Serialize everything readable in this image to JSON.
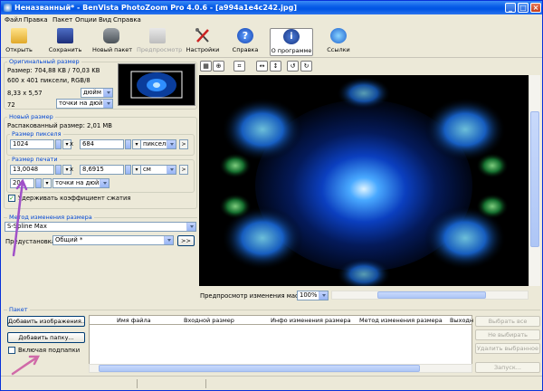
{
  "window": {
    "title": "Неназванный* - BenVista PhotoZoom Pro 4.0.6 - [a994a1e4c242.jpg]"
  },
  "menu": [
    "Файл",
    "Правка",
    "Пакет",
    "Опции",
    "Вид",
    "Справка"
  ],
  "toolbar": {
    "open": "Открыть",
    "save": "Сохранить",
    "new_batch": "Новый пакет",
    "preview": "Предпросмотр",
    "settings": "Настройки",
    "help": "Справка",
    "about": "О программе",
    "links": "Ссылки"
  },
  "original": {
    "group_label": "Оригинальный размер",
    "size_line": "Размер: 704,88 KB / 70,03 KB",
    "pixels_line": "600 x 401 пиксели, RGB/8",
    "inch_value": "8,33 x 5,57",
    "inch_unit": "дюйм",
    "dpi_value": "72",
    "dpi_unit": "точки на дюйм"
  },
  "new_size": {
    "group_label": "Новый размер",
    "unpacked": "Распакованный размер: 2,01 MB",
    "pixel_group": "Размер пикселя",
    "width_px": "1024",
    "height_px": "684",
    "px_unit": "пиксели",
    "print_group": "Размер печати",
    "width_print": "13,0048",
    "height_print": "8,6915",
    "print_unit": "см",
    "resolution": "200",
    "res_unit": "точки на дюйм",
    "times": "x",
    "keep_ratio": "Удерживать коэффициент сжатия",
    "keep_ratio_checked": true
  },
  "method": {
    "group_label": "Метод изменения размера",
    "algorithm": "S-Spline Max",
    "preset_label": "Предустановка:",
    "preset_value": "Общий *",
    "more": ">>"
  },
  "preview_bar": {
    "label": "Предпросмотр изменения масштаба:",
    "zoom": "100%"
  },
  "batch": {
    "group_label": "Пакет",
    "add_images": "Добавить изображения...",
    "add_folder": "Добавить папку...",
    "include_subfolders": "Включая подпапки",
    "include_subfolders_checked": false,
    "columns": [
      "Имя файла",
      "Входной размер",
      "Инфо изменения размера",
      "Метод изменения размера",
      "Выходн"
    ],
    "select_all": "Выбрать все",
    "deselect": "Не выбирать",
    "remove_selected": "Удалить выбранное",
    "run": "Запуск..."
  },
  "colors": {
    "titlebar": "#0054e3",
    "accent_label": "#0046d5",
    "annotation_arrow": "#a050c8"
  }
}
